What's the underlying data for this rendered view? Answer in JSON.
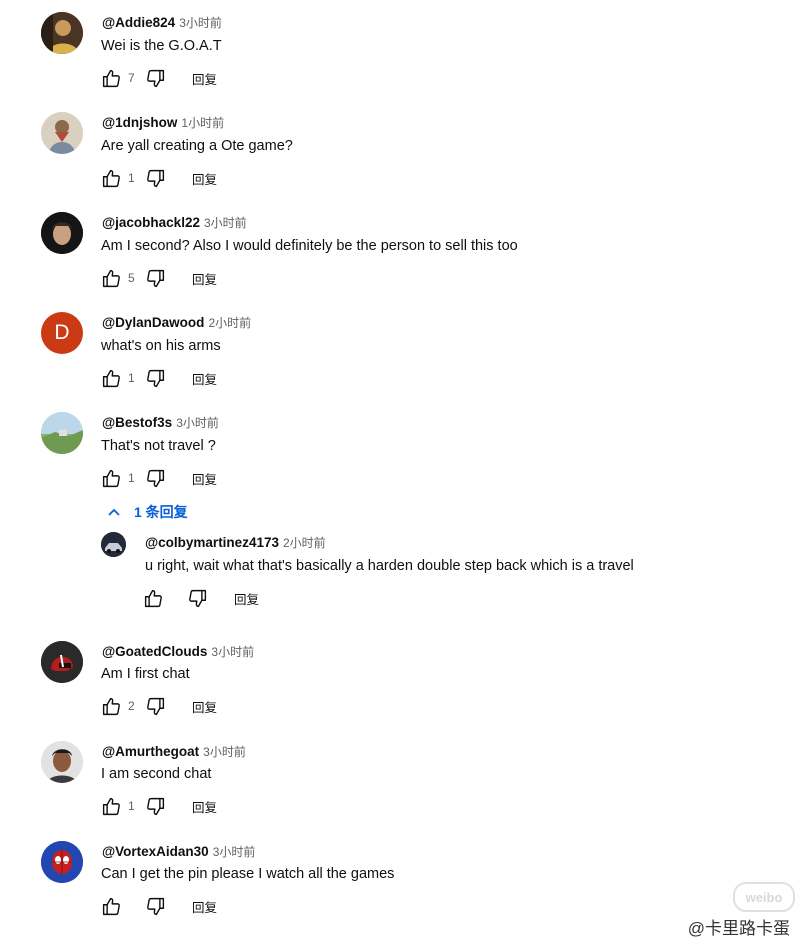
{
  "comments": [
    {
      "author": "@Addie824",
      "time": "3小时前",
      "text": "Wei is the G.O.A.T",
      "likes": "7",
      "reply_label": "回复",
      "avatar": "person-gold-icon"
    },
    {
      "author": "@1dnjshow",
      "time": "1小时前",
      "text": "Are yall creating a Ote game?",
      "likes": "1",
      "reply_label": "回复",
      "avatar": "painting-icon"
    },
    {
      "author": "@jacobhackl22",
      "time": "3小时前",
      "text": "Am I second? Also I would definitely be the person to sell this too",
      "likes": "5",
      "reply_label": "回复",
      "avatar": "face-dark-icon"
    },
    {
      "author": "@DylanDawood",
      "time": "2小时前",
      "text": "what's on his arms",
      "likes": "1",
      "reply_label": "回复",
      "avatar_letter": "D",
      "avatar_color": "#c93a15"
    },
    {
      "author": "@Bestof3s",
      "time": "3小时前",
      "text": "That's not travel ?",
      "likes": "1",
      "reply_label": "回复",
      "avatar": "landscape-icon"
    },
    {
      "author": "@GoatedClouds",
      "time": "3小时前",
      "text": "Am I first chat",
      "likes": "2",
      "reply_label": "回复",
      "avatar": "helmet-icon"
    },
    {
      "author": "@Amurthegoat",
      "time": "3小时前",
      "text": "I am second chat",
      "likes": "1",
      "reply_label": "回复",
      "avatar": "person-icon"
    },
    {
      "author": "@VortexAidan30",
      "time": "3小时前",
      "text": "Can I get the pin please I watch all the games",
      "likes": "",
      "reply_label": "回复",
      "avatar": "spider-icon"
    }
  ],
  "replies_toggle": "1 条回复",
  "reply": {
    "author": "@colbymartinez4173",
    "time": "2小时前",
    "text": "u right, wait what that's basically a harden double step back which is a travel",
    "likes": "",
    "reply_label": "回复",
    "avatar": "car-icon"
  },
  "watermark": "@卡里路卡蛋",
  "watermark_logo": "weibo",
  "colors": {
    "link_blue": "#065fd4",
    "muted": "#606060",
    "text": "#0f0f0f"
  }
}
